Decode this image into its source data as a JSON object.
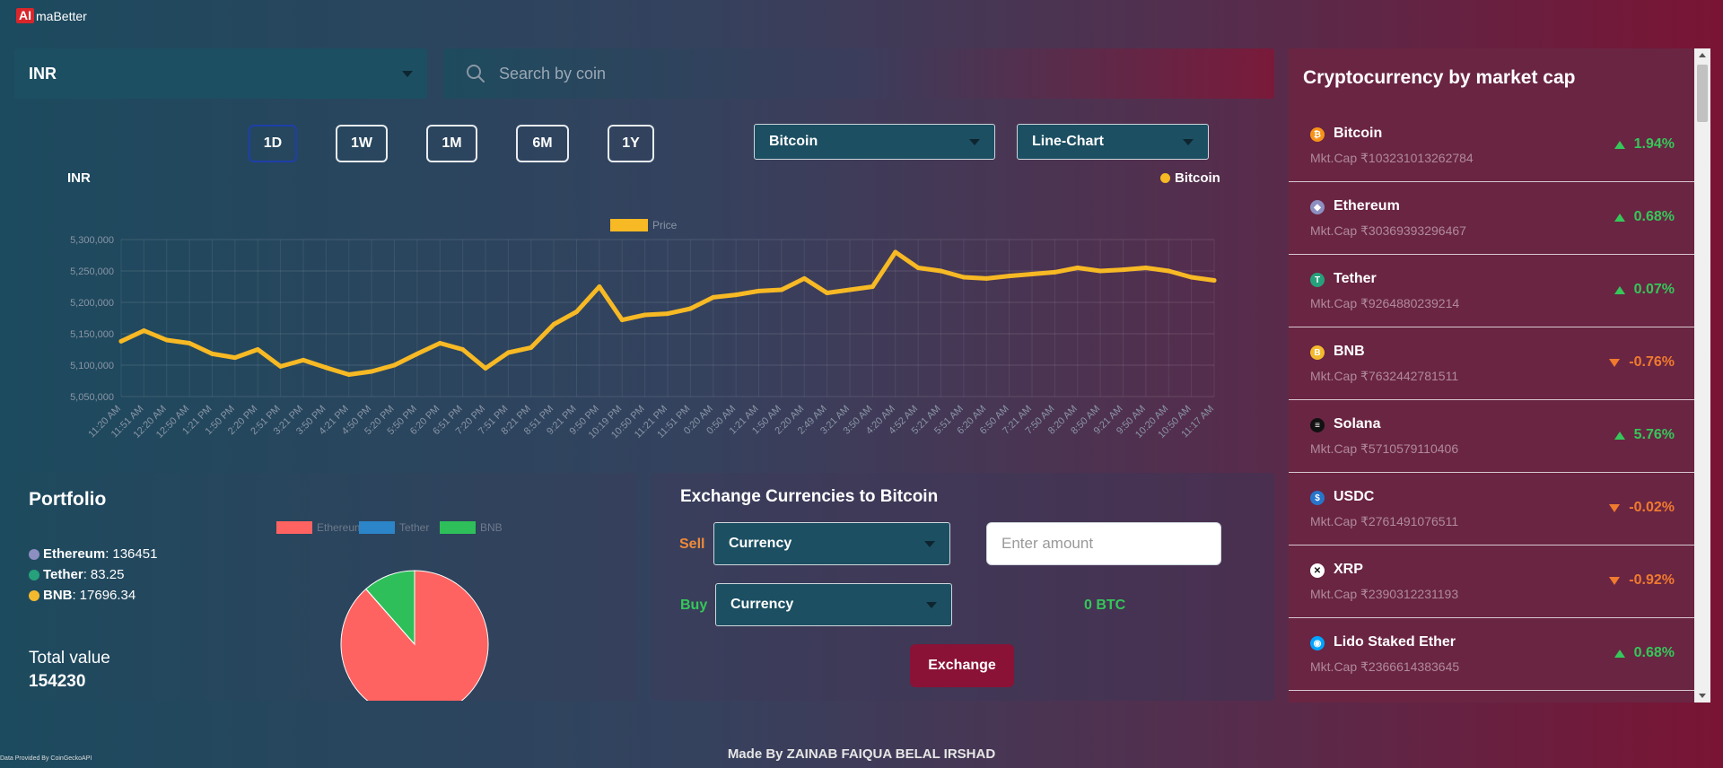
{
  "brand": {
    "logo_mark": "AI",
    "logo_rest": "maBetter"
  },
  "currency": {
    "selected": "INR"
  },
  "search": {
    "placeholder": "Search by coin"
  },
  "time_ranges": [
    {
      "label": "1D",
      "active": true
    },
    {
      "label": "1W",
      "active": false
    },
    {
      "label": "1M",
      "active": false
    },
    {
      "label": "6M",
      "active": false
    },
    {
      "label": "1Y",
      "active": false
    }
  ],
  "coin_select": {
    "selected": "Bitcoin"
  },
  "chart_type_select": {
    "selected": "Line-Chart"
  },
  "chart_header": {
    "currency_label": "INR",
    "coin_legend": "Bitcoin"
  },
  "chart_data": {
    "type": "line",
    "title": "",
    "legend": [
      "Price"
    ],
    "ylim": [
      5050000,
      5300000
    ],
    "yticks": [
      "5,050,000",
      "5,100,000",
      "5,150,000",
      "5,200,000",
      "5,250,000",
      "5,300,000"
    ],
    "x": [
      "11:20 AM",
      "11:51 AM",
      "12:20 AM",
      "12:50 AM",
      "1:21 PM",
      "1:50 PM",
      "2:20 PM",
      "2:51 PM",
      "3:21 PM",
      "3:50 PM",
      "4:21 PM",
      "4:50 PM",
      "5:20 PM",
      "5:50 PM",
      "6:20 PM",
      "6:51 PM",
      "7:20 PM",
      "7:51 PM",
      "8:21 PM",
      "8:51 PM",
      "9:21 PM",
      "9:50 PM",
      "10:19 PM",
      "10:50 PM",
      "11:21 PM",
      "11:51 PM",
      "0:20 AM",
      "0:50 AM",
      "1:21 AM",
      "1:50 AM",
      "2:20 AM",
      "2:49 AM",
      "3:21 AM",
      "3:50 AM",
      "4:20 AM",
      "4:52 AM",
      "5:21 AM",
      "5:51 AM",
      "6:20 AM",
      "6:50 AM",
      "7:21 AM",
      "7:50 AM",
      "8:20 AM",
      "8:50 AM",
      "9:21 AM",
      "9:50 AM",
      "10:20 AM",
      "10:50 AM",
      "11:17 AM"
    ],
    "series": [
      {
        "name": "Price",
        "color": "#f7b924",
        "values": [
          5138000,
          5155000,
          5140000,
          5135000,
          5118000,
          5112000,
          5125000,
          5098000,
          5108000,
          5096000,
          5085000,
          5090000,
          5100000,
          5118000,
          5135000,
          5125000,
          5095000,
          5120000,
          5128000,
          5165000,
          5185000,
          5225000,
          5172000,
          5180000,
          5182000,
          5190000,
          5208000,
          5212000,
          5218000,
          5220000,
          5238000,
          5215000,
          5220000,
          5225000,
          5280000,
          5255000,
          5250000,
          5240000,
          5238000,
          5242000,
          5245000,
          5248000,
          5255000,
          5250000,
          5252000,
          5255000,
          5250000,
          5240000,
          5235000
        ]
      }
    ]
  },
  "portfolio": {
    "title": "Portfolio",
    "holdings": [
      {
        "icon": "ethereum-icon",
        "name": "Ethereum",
        "value": "136451",
        "color": "#8c8fbf"
      },
      {
        "icon": "tether-icon",
        "name": "Tether",
        "value": "83.25",
        "color": "#26a17b"
      },
      {
        "icon": "bnb-icon",
        "name": "BNB",
        "value": "17696.34",
        "color": "#f3ba2f"
      }
    ],
    "total_label": "Total value",
    "total_value": "154230",
    "pie": {
      "type": "pie",
      "legend": [
        "Ethereum",
        "Tether",
        "BNB"
      ],
      "colors": [
        "#ff6361",
        "#2b85c8",
        "#2ebf5a"
      ],
      "values": [
        136451,
        83.25,
        17696.34
      ]
    }
  },
  "exchange": {
    "title": "Exchange Currencies to Bitcoin",
    "sell_label": "Sell",
    "buy_label": "Buy",
    "sell_select": "Currency",
    "buy_select": "Currency",
    "amount_placeholder": "Enter amount",
    "result": "0 BTC",
    "button": "Exchange"
  },
  "market": {
    "title": "Cryptocurrency by market cap",
    "coins": [
      {
        "name": "Bitcoin",
        "mcap": "Mkt.Cap ₹103231013262784",
        "change": "1.94%",
        "dir": "up",
        "icon": "bitcoin-icon",
        "glyph": "₿",
        "color": "#f7931a"
      },
      {
        "name": "Ethereum",
        "mcap": "Mkt.Cap ₹30369393296467",
        "change": "0.68%",
        "dir": "up",
        "icon": "ethereum-icon",
        "glyph": "◆",
        "color": "#8c8fbf"
      },
      {
        "name": "Tether",
        "mcap": "Mkt.Cap ₹9264880239214",
        "change": "0.07%",
        "dir": "up",
        "icon": "tether-icon",
        "glyph": "T",
        "color": "#26a17b"
      },
      {
        "name": "BNB",
        "mcap": "Mkt.Cap ₹7632442781511",
        "change": "-0.76%",
        "dir": "down",
        "icon": "bnb-icon",
        "glyph": "B",
        "color": "#f3ba2f"
      },
      {
        "name": "Solana",
        "mcap": "Mkt.Cap ₹5710579110406",
        "change": "5.76%",
        "dir": "up",
        "icon": "solana-icon",
        "glyph": "≡",
        "color": "#111111"
      },
      {
        "name": "USDC",
        "mcap": "Mkt.Cap ₹2761491076511",
        "change": "-0.02%",
        "dir": "down",
        "icon": "usdc-icon",
        "glyph": "$",
        "color": "#2775ca"
      },
      {
        "name": "XRP",
        "mcap": "Mkt.Cap ₹2390312231193",
        "change": "-0.92%",
        "dir": "down",
        "icon": "xrp-icon",
        "glyph": "✕",
        "color": "#ffffff"
      },
      {
        "name": "Lido Staked Ether",
        "mcap": "Mkt.Cap ₹2366614383645",
        "change": "0.68%",
        "dir": "up",
        "icon": "lido-icon",
        "glyph": "◉",
        "color": "#00a3ff"
      }
    ]
  },
  "footer": {
    "made_by": "Made By ZAINAB FAIQUA BELAL IRSHAD",
    "credit": "Data Provided By CoinGeckoAPI"
  }
}
